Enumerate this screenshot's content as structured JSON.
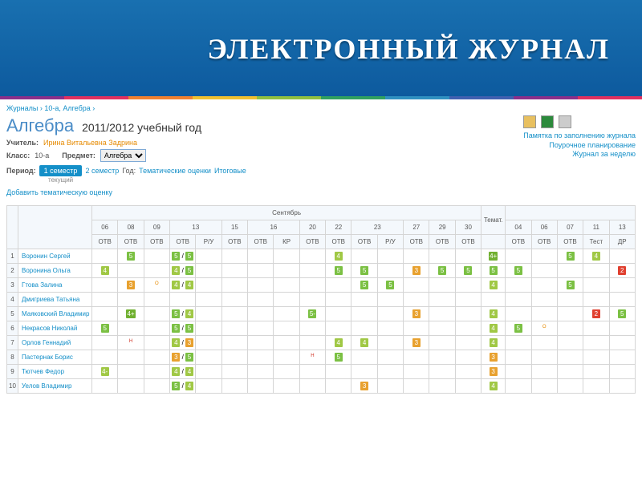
{
  "banner_title": "ЭЛЕКТРОННЫЙ ЖУРНАЛ",
  "stripe_colors": [
    "#8a2f8a",
    "#e03060",
    "#f08030",
    "#f0c030",
    "#90c040",
    "#30a060",
    "#3090c0",
    "#4060b0",
    "#8a2f8a",
    "#e03060"
  ],
  "breadcrumb": {
    "parts": [
      "Журналы",
      "10-а, Алгебра"
    ]
  },
  "subject": "Алгебра",
  "year": "2011/2012 учебный год",
  "meta": {
    "teacher_label": "Учитель:",
    "teacher": "Ирина Витальевна Задрина",
    "class_label": "Класс:",
    "class": "10-а",
    "subject_label": "Предмет:",
    "subject_value": "Алгебра"
  },
  "period": {
    "label": "Период:",
    "active": "1 семестр",
    "sem2": "2 семестр",
    "year": "Год:",
    "thematic": "Тематические оценки",
    "final": "Итоговые",
    "current": "текущий"
  },
  "add_thematic": "Добавить тематическую оценку",
  "right_links": [
    "Памятка по заполнению журнала",
    "Поурочное планирование",
    "Журнал за неделю"
  ],
  "month": "Сентябрь",
  "cols": [
    {
      "d": "06",
      "t": "ОТВ"
    },
    {
      "d": "08",
      "t": "ОТВ"
    },
    {
      "d": "09",
      "t": "ОТВ"
    },
    {
      "d": "13",
      "t": "ОТВ",
      "w": 2
    },
    {
      "d": "",
      "t": "Р/У"
    },
    {
      "d": "15",
      "t": "ОТВ"
    },
    {
      "d": "16",
      "t": "ОТВ"
    },
    {
      "d": "",
      "t": "КР"
    },
    {
      "d": "20",
      "t": "ОТВ"
    },
    {
      "d": "22",
      "t": "ОТВ"
    },
    {
      "d": "23",
      "t": "ОТВ",
      "w": 2
    },
    {
      "d": "",
      "t": "Р/У"
    },
    {
      "d": "27",
      "t": "ОТВ"
    },
    {
      "d": "29",
      "t": "ОТВ"
    },
    {
      "d": "30",
      "t": "ОТВ"
    },
    {
      "d": "Темат.",
      "t": ""
    },
    {
      "d": "04",
      "t": "ОТВ"
    },
    {
      "d": "06",
      "t": "ОТВ"
    },
    {
      "d": "07",
      "t": "ОТВ"
    },
    {
      "d": "11",
      "t": "Тест"
    },
    {
      "d": "13",
      "t": "ДР"
    }
  ],
  "students": [
    {
      "n": "1",
      "name": "Воронин Сергей",
      "g": {
        "1": "5",
        "3": "5 / 5",
        "9": "4",
        "15": "4+",
        "18": "5",
        "19": "4"
      }
    },
    {
      "n": "2",
      "name": "Воронина Ольга",
      "g": {
        "0": "4",
        "3": "4 / 5",
        "9": "5",
        "10": "5",
        "12": "3",
        "13": "5",
        "14": "5",
        "15": "5",
        "16": "5",
        "20": "2"
      }
    },
    {
      "n": "3",
      "name": "Гтова Залина",
      "g": {
        "1": "3",
        "3": "4 / 4",
        "10": "5",
        "11": "5",
        "15": "4",
        "18": "5"
      },
      "o": {
        "2": "О"
      }
    },
    {
      "n": "4",
      "name": "Дмигриева Татьяна",
      "g": {}
    },
    {
      "n": "5",
      "name": "Маяковский Владимир",
      "g": {
        "1": "4+",
        "3": "5 / 4",
        "8": "5-",
        "12": "3",
        "15": "4",
        "19": "2",
        "20": "5"
      }
    },
    {
      "n": "6",
      "name": "Некрасов Николай",
      "g": {
        "0": "5",
        "3": "5 / 5",
        "15": "4",
        "16": "5"
      },
      "o": {
        "17": "О"
      }
    },
    {
      "n": "7",
      "name": "Орлов Геннадий",
      "g": {
        "3": "4 / 3",
        "9": "4",
        "10": "4",
        "12": "3",
        "15": "4"
      },
      "n2": {
        "1": "Н"
      }
    },
    {
      "n": "8",
      "name": "Пастернак Борис",
      "g": {
        "3": "3 / 5",
        "9": "5",
        "15": "3"
      },
      "n2": {
        "8": "Н"
      }
    },
    {
      "n": "9",
      "name": "Тютчев Федор",
      "g": {
        "0": "4-",
        "3": "4 / 4",
        "15": "3"
      }
    },
    {
      "n": "10",
      "name": "Уелов Владимир",
      "g": {
        "3": "5 / 4",
        "10": "3",
        "15": "4"
      }
    }
  ]
}
